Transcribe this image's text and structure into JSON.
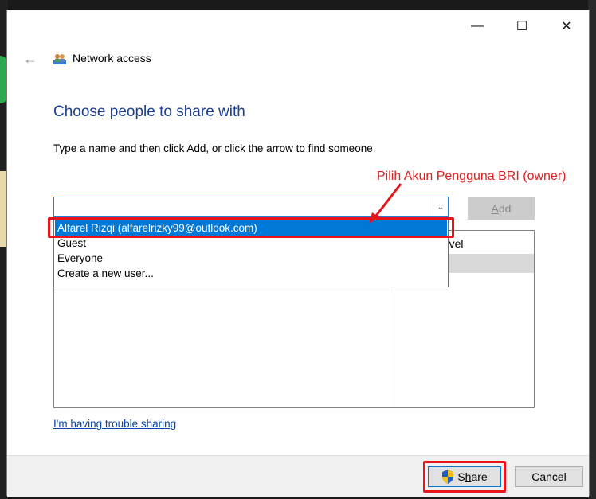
{
  "window": {
    "title": "Network access",
    "minimize_glyph": "—",
    "maximize_glyph": "☐",
    "close_glyph": "✕",
    "back_glyph": "←"
  },
  "main": {
    "heading": "Choose people to share with",
    "instruction": "Type a name and then click Add, or click the arrow to find someone.",
    "combo_value": "",
    "add_label_prefix": "",
    "add_label_underlined": "A",
    "add_label_rest": "dd",
    "permission_header": "Level",
    "help_link": "I'm having trouble sharing"
  },
  "dropdown": {
    "items": [
      {
        "label": "Alfarel Rizqi (alfarelrizky99@outlook.com)"
      },
      {
        "label": "Guest"
      },
      {
        "label": "Everyone"
      },
      {
        "label": "Create a new user..."
      }
    ]
  },
  "annotation": {
    "text": "Pilih Akun Pengguna BRI (owner)",
    "color": "#e02020"
  },
  "footer": {
    "share_prefix": "S",
    "share_underlined": "h",
    "share_rest": "are",
    "cancel_label": "Cancel"
  },
  "colors": {
    "heading": "#1c3f94",
    "selection": "#0078d7",
    "highlight": "#e8141c"
  }
}
